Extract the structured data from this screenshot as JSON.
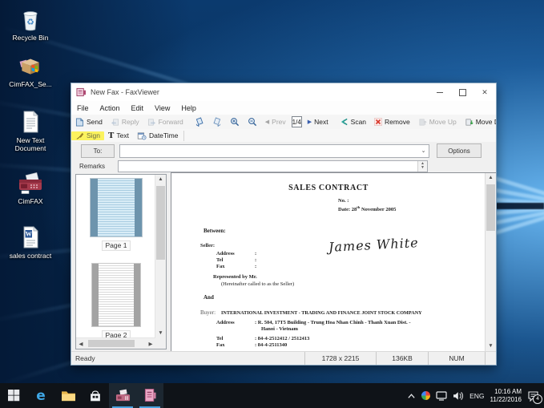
{
  "desktop": {
    "icons": [
      {
        "label": "Recycle Bin"
      },
      {
        "label": "CimFAX_Se..."
      },
      {
        "label": "New Text Document"
      },
      {
        "label": "CimFAX"
      },
      {
        "label": "sales contract"
      }
    ]
  },
  "window": {
    "title": "New Fax - FaxViewer",
    "menus": [
      "File",
      "Action",
      "Edit",
      "View",
      "Help"
    ],
    "toolbar": {
      "send": "Send",
      "reply": "Reply",
      "forward": "Forward",
      "prev": "Prev",
      "page": "1/4",
      "next": "Next",
      "scan": "Scan",
      "remove": "Remove",
      "move_up": "Move Up",
      "move_down": "Move Do"
    },
    "markup_toolbar": {
      "sign": "Sign",
      "text": "Text",
      "datetime": "DateTime"
    },
    "recipient_row": {
      "to": "To:",
      "to_value": "",
      "options": "Options"
    },
    "remarks_row": {
      "label": "Remarks",
      "value": ""
    },
    "thumbnails": {
      "page1": "Page 1",
      "page2": "Page 2"
    },
    "status": {
      "ready": "Ready",
      "dimensions": "1728 x 2215",
      "filesize": "136KB",
      "keyboard": "NUM"
    }
  },
  "document": {
    "title": "SALES CONTRACT",
    "no_label": "No. :",
    "date_prefix": "Date: 28",
    "date_sup": "th",
    "date_suffix": " November 2005",
    "between": "Between:",
    "seller": {
      "label": "Seller:",
      "address_label": "Address",
      "tel_label": "Tel",
      "fax_label": "Fax",
      "colon": ":"
    },
    "signature": "James White",
    "represented": "Represented by Mr.",
    "hereinafter": "(Hereinafter called to as the Seller)",
    "and": "And",
    "buyer": {
      "label": "Buyer:",
      "name": "INTERNATIONAL INVESTMENT - TRADING AND FINANCE JOINT STOCK COMPANY",
      "address_label": "Address",
      "address_value": ": R. 504, 17T5 Building - Trung Hoa Nhan Chinh - Thanh Xuan Dist. -",
      "address_value2": "Hanoi - Vietnam",
      "tel_label": "Tel",
      "tel_value": ": 84-4-2512412 / 2512413",
      "fax_label": "Fax",
      "fax_value": ": 84-4-2511340"
    }
  },
  "taskbar": {
    "tray": {
      "language": "ENG",
      "time": "10:16 AM",
      "date": "11/22/2016",
      "notification_count": "4"
    }
  }
}
